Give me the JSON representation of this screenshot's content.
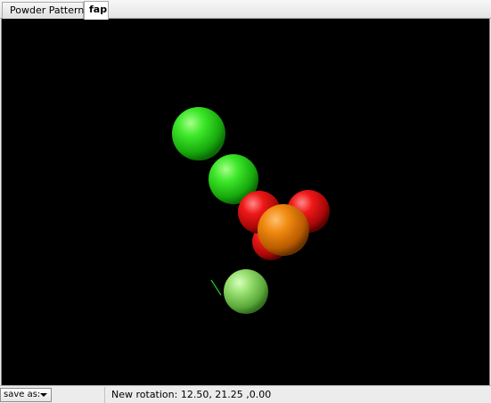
{
  "tabs": [
    {
      "label": "Powder Patterns",
      "active": false
    },
    {
      "label": "fap",
      "active": true
    }
  ],
  "viewport": {
    "background": "#000000",
    "atoms": [
      {
        "color": "#33dd22",
        "role": "green-atom"
      },
      {
        "color": "#33dd22",
        "role": "green-atom"
      },
      {
        "color": "#dd1111",
        "role": "red-atom"
      },
      {
        "color": "#dd1111",
        "role": "red-atom"
      },
      {
        "color": "#dd1111",
        "role": "red-atom"
      },
      {
        "color": "#ee7700",
        "role": "orange-atom"
      },
      {
        "color": "#8ed66a",
        "role": "light-green-atom"
      }
    ],
    "axis_color": "#22cc22"
  },
  "status": {
    "save_label": "save as:",
    "rotation_text": "New rotation: 12.50, 21.25 ,0.00"
  }
}
